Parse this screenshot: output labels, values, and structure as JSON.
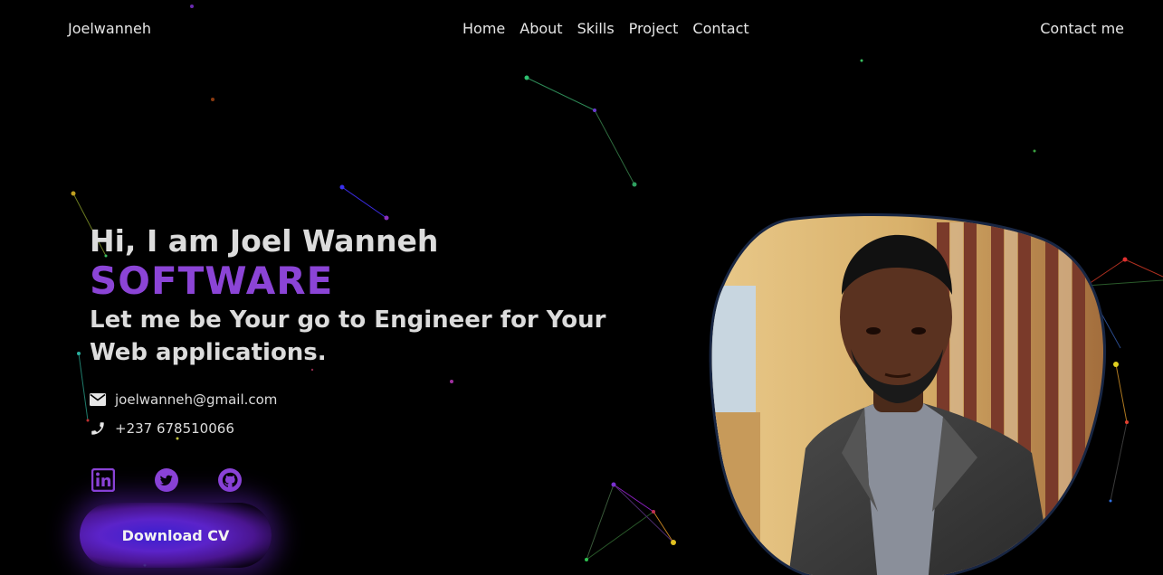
{
  "nav": {
    "brand": "Joelwanneh",
    "links": [
      "Home",
      "About",
      "Skills",
      "Project",
      "Contact"
    ],
    "contact_button": "Contact me"
  },
  "hero": {
    "greeting": "Hi, I am Joel Wanneh",
    "role": "SOFTWARE",
    "tagline": "Let me be Your go to Engineer for Your Web applications.",
    "email": "joelwanneh@gmail.com",
    "phone": "+237 678510066",
    "cv_button": "Download CV"
  },
  "socials": [
    {
      "name": "linkedin-icon"
    },
    {
      "name": "twitter-icon"
    },
    {
      "name": "github-icon"
    }
  ],
  "colors": {
    "background": "#000000",
    "accent": "#8b44d6",
    "text": "#dcdcdc"
  }
}
